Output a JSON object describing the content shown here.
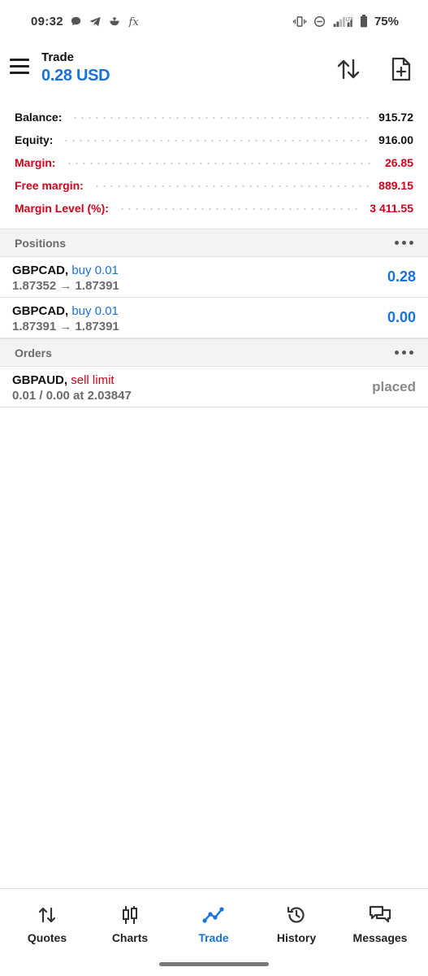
{
  "status_bar": {
    "time": "09:32",
    "battery": "75%",
    "left_icons": [
      "chat-bubble-icon",
      "telegram-icon",
      "pot-icon",
      "fx-icon"
    ],
    "right_icons": [
      "vibrate-icon",
      "dnd-icon",
      "signal-icon",
      "battery-icon"
    ]
  },
  "header": {
    "title": "Trade",
    "balance_pl": "0.28 USD"
  },
  "summary": [
    {
      "label": "Balance:",
      "value": "915.72",
      "color": "#111111"
    },
    {
      "label": "Equity:",
      "value": "916.00",
      "color": "#111111"
    },
    {
      "label": "Margin:",
      "value": "26.85",
      "color": "#d0021b"
    },
    {
      "label": "Free margin:",
      "value": "889.15",
      "color": "#d0021b"
    },
    {
      "label": "Margin Level (%):",
      "value": "3 411.55",
      "color": "#d0021b"
    }
  ],
  "positions": {
    "title": "Positions",
    "items": [
      {
        "symbol": "GBPCAD,",
        "side": "buy 0.01",
        "prices": "1.87352 → 1.87391",
        "profit": "0.28"
      },
      {
        "symbol": "GBPCAD,",
        "side": "buy 0.01",
        "prices": "1.87391 → 1.87391",
        "profit": "0.00"
      }
    ]
  },
  "orders": {
    "title": "Orders",
    "items": [
      {
        "symbol": "GBPAUD,",
        "side": "sell limit",
        "details": "0.01 / 0.00 at 2.03847",
        "status": "placed"
      }
    ]
  },
  "bottom_nav": {
    "items": [
      {
        "label": "Quotes",
        "icon": "quotes-arrows-icon",
        "active": false
      },
      {
        "label": "Charts",
        "icon": "candlestick-icon",
        "active": false
      },
      {
        "label": "Trade",
        "icon": "trade-line-icon",
        "active": true
      },
      {
        "label": "History",
        "icon": "history-icon",
        "active": false
      },
      {
        "label": "Messages",
        "icon": "messages-icon",
        "active": false
      }
    ]
  },
  "colors": {
    "accent": "#1a73d9",
    "loss_red": "#d0021b",
    "muted": "#6b6b6b"
  }
}
